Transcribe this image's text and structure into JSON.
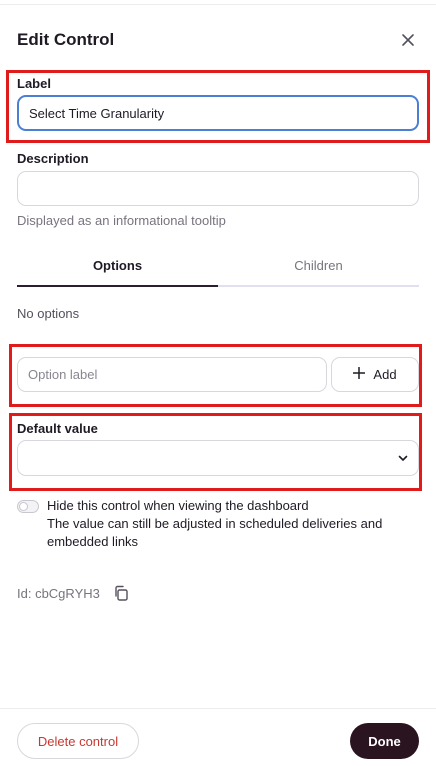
{
  "dialog": {
    "title": "Edit Control",
    "close_icon": "close-icon"
  },
  "label_field": {
    "label": "Label",
    "value": "Select Time Granularity"
  },
  "description_field": {
    "label": "Description",
    "value": "",
    "hint": "Displayed as an informational tooltip"
  },
  "tabs": [
    {
      "label": "Options",
      "active": true
    },
    {
      "label": "Children",
      "active": false
    }
  ],
  "options": {
    "empty_text": "No options",
    "option_placeholder": "Option label",
    "add_label": "Add",
    "add_icon": "plus-icon"
  },
  "default_value": {
    "label": "Default value",
    "selected": "",
    "chevron_icon": "chevron-down-icon"
  },
  "hide_control": {
    "enabled": false,
    "text": "Hide this control when viewing the dashboard",
    "subtext": "The value can still be adjusted in scheduled deliveries and embedded links"
  },
  "control_id": {
    "text": "Id: cbCgRYH3",
    "copy_icon": "copy-icon"
  },
  "footer": {
    "delete_label": "Delete control",
    "done_label": "Done"
  },
  "colors": {
    "highlight": "#e01b1b",
    "focus": "#4a7fd4",
    "delete_text": "#c9372f",
    "done_bg": "#2a1420"
  }
}
